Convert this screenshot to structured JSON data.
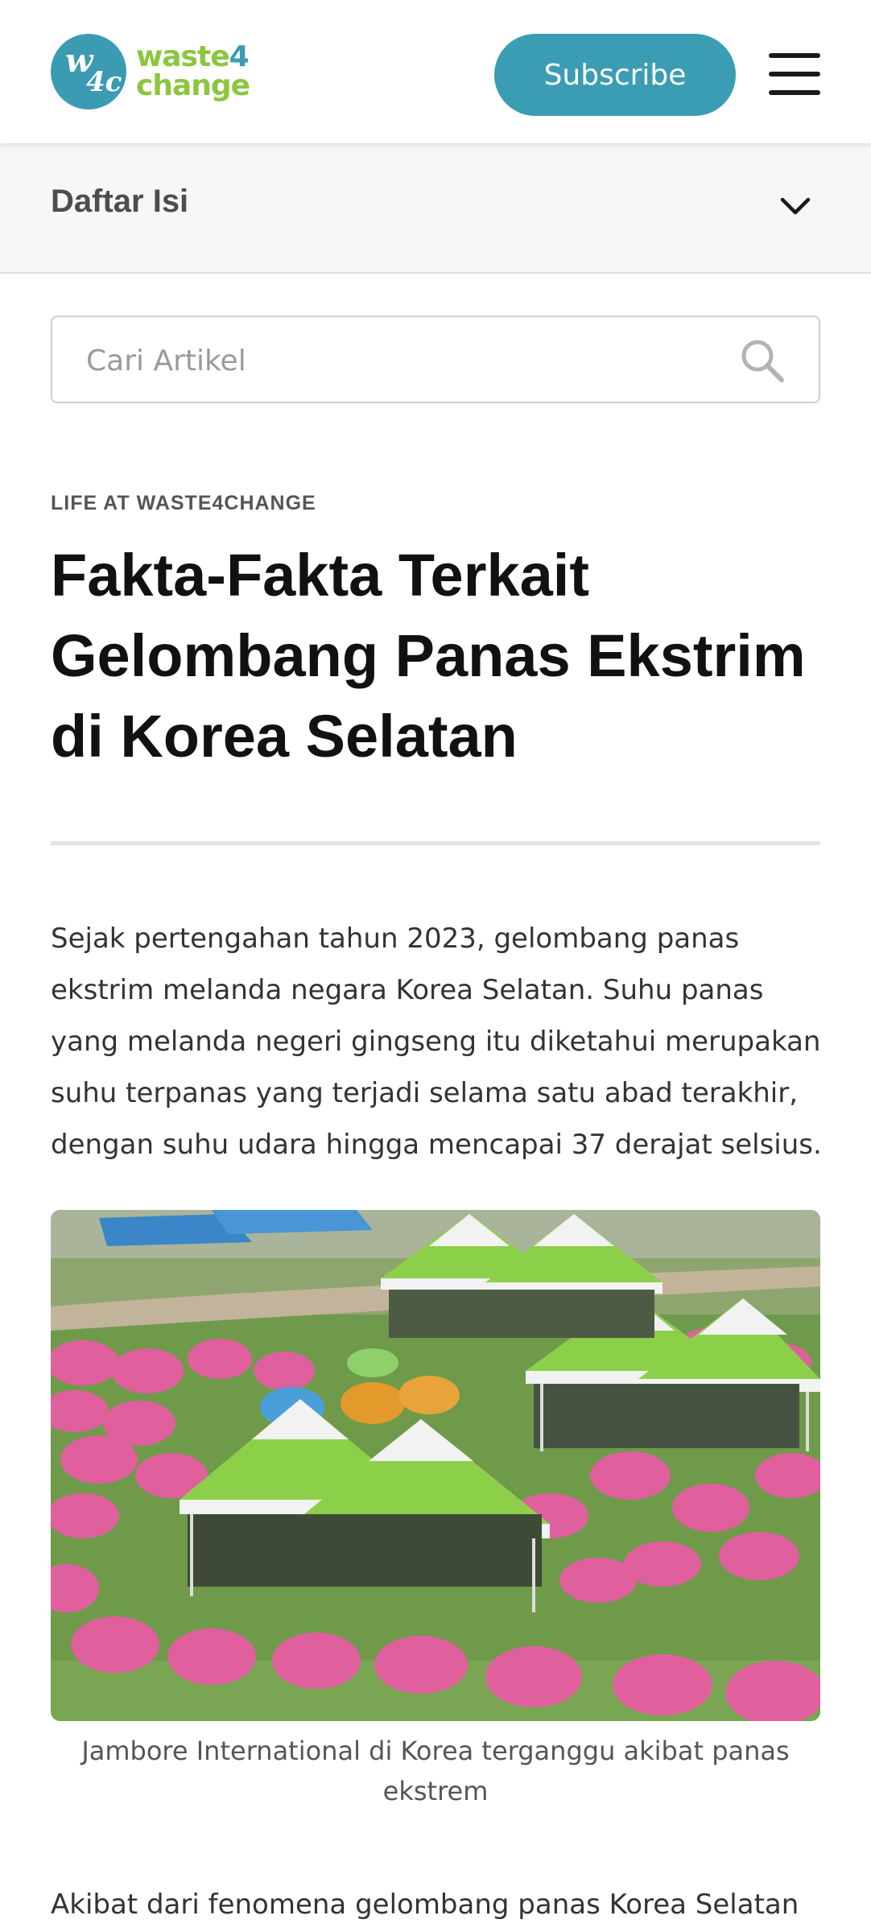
{
  "brand": {
    "monogram": "w4c",
    "word1": "waste",
    "word1_num": "4",
    "word2": "change",
    "colors": {
      "teal": "#3a9bb3",
      "green": "#8cc63f"
    }
  },
  "header": {
    "subscribe_label": "Subscribe",
    "menu_icon": "hamburger-icon"
  },
  "toc": {
    "label": "Daftar Isi",
    "icon": "chevron-down-icon"
  },
  "search": {
    "placeholder": "Cari Artikel",
    "icon": "search-icon"
  },
  "article": {
    "category": "LIFE AT WASTE4CHANGE",
    "title": "Fakta-Fakta Terkait Gelombang Panas Ekstrim di Korea Selatan",
    "paragraph1": "Sejak pertengahan tahun 2023, gelombang panas ekstrim melanda negara Korea Selatan. Suhu panas yang melanda negeri gingseng itu diketahui merupakan suhu terpanas yang terjadi selama satu abad terakhir, dengan suhu udara hingga mencapai 37 derajat selsius.",
    "image_caption": "Jambore International di Korea terganggu akibat panas ekstrem",
    "paragraph2": "Akibat dari fenomena gelombang panas Korea Selatan"
  }
}
